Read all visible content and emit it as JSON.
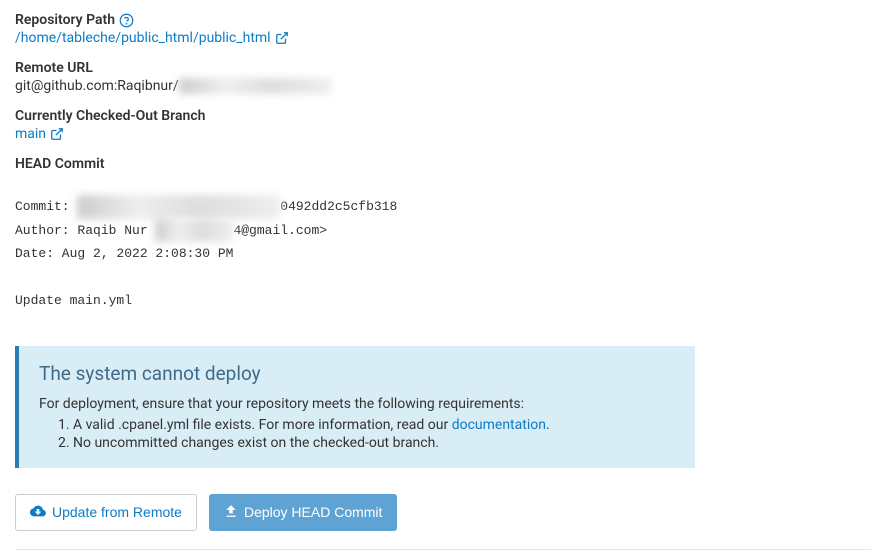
{
  "repo": {
    "path_label": "Repository Path",
    "path_value": "/home/tableche/public_html/public_html",
    "remote_url_label": "Remote URL",
    "remote_url_prefix": "git@github.com:Raqibnur/",
    "remote_url_hidden": "xxxxxxxxxxxxxxxxxxxxxx",
    "branch_label": "Currently Checked-Out Branch",
    "branch_value": "main",
    "head_commit_label": "HEAD Commit"
  },
  "commit": {
    "commit_prefix": "Commit: ",
    "commit_hidden": "xxxxxxxxxxxxxxxxxxxxxxxxxx",
    "commit_suffix": "0492dd2c5cfb318",
    "author_prefix": "Author: Raqib Nur ",
    "author_hidden": "xxxxxxxxxx",
    "author_suffix": "4@gmail.com>",
    "date": "Date: Aug 2, 2022 2:08:30 PM",
    "message": "Update main.yml"
  },
  "alert": {
    "title": "The system cannot deploy",
    "intro": "For deployment, ensure that your repository meets the following requirements:",
    "item1_pre": "A valid .cpanel.yml file exists. For more information, read our ",
    "item1_link": "documentation",
    "item1_post": ".",
    "item2": "No uncommitted changes exist on the checked-out branch."
  },
  "buttons": {
    "update": "Update from Remote",
    "deploy": "Deploy HEAD Commit"
  }
}
